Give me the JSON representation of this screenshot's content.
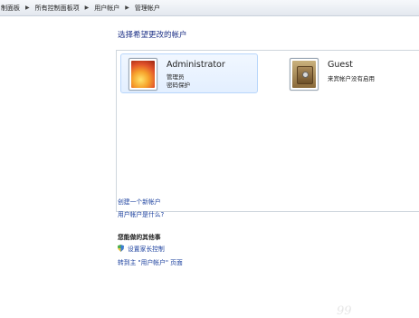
{
  "breadcrumb": {
    "items": [
      "制面板",
      "所有控制面板项",
      "用户帐户",
      "管理帐户"
    ]
  },
  "heading": "选择希望更改的帐户",
  "accounts": [
    {
      "name": "Administrator",
      "lines": [
        "管理员",
        "密码保护"
      ],
      "selected": true
    },
    {
      "name": "Guest",
      "lines": [
        "来宾帐户没有启用"
      ],
      "selected": false
    }
  ],
  "links": {
    "create_account": "创建一个新帐户",
    "what_is": "用户帐户是什么?"
  },
  "other": {
    "title": "您能做的其他事",
    "parental": "设置家长控制",
    "goto_main": "转到主 \"用户帐户\" 页面"
  },
  "watermark": "99",
  "icons": [
    "chevron-right-icon",
    "administrator-avatar-icon",
    "guest-avatar-icon",
    "shield-icon"
  ],
  "colors": {
    "link": "#1a3f9e",
    "heading": "#1e3287",
    "selected_bg": "#e3efff"
  }
}
